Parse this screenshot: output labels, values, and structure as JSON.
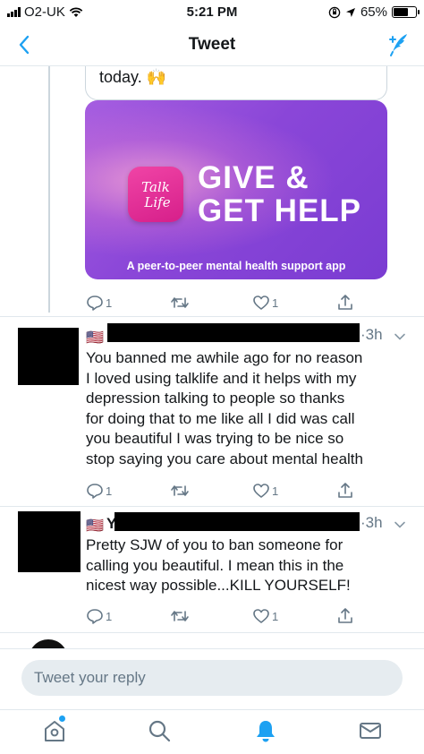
{
  "status_bar": {
    "carrier": "O2-UK",
    "time": "5:21 PM",
    "battery": "65%",
    "battery_level": 0.65
  },
  "nav": {
    "title": "Tweet",
    "icons": [
      "chevron-left-icon",
      "compose-tweet-icon"
    ]
  },
  "original_tweet": {
    "text_end": "today. 🙌",
    "card": {
      "logo_text": "Talk Life",
      "headline_line1": "GIVE &",
      "headline_line2": "GET HELP",
      "caption": "A peer-to-peer mental health support app"
    },
    "actions": {
      "reply_count": "1",
      "like_count": "1"
    }
  },
  "replies": [
    {
      "flag": "🇺🇸",
      "time": "3h",
      "text_lines": [
        "You banned me awhile ago for no reason",
        "I loved using talklife and it helps with my",
        "depression talking to people so thanks",
        "for doing that to me like all I did was call",
        "you beautiful I was trying to be nice so",
        "stop saying you care about mental health"
      ],
      "actions": {
        "reply_count": "1",
        "like_count": "1"
      }
    },
    {
      "flag": "🇺🇸",
      "name_initial": "Y",
      "time": "3h",
      "text_lines": [
        "Pretty SJW of you to ban someone for",
        "calling you beautiful. I mean this in the",
        "nicest way possible...KILL YOURSELF!"
      ],
      "actions": {
        "reply_count": "1",
        "like_count": "1"
      }
    }
  ],
  "composer": {
    "placeholder": "Tweet your reply"
  },
  "tab_bar": {
    "tabs": [
      "home-icon",
      "search-icon",
      "notifications-icon",
      "messages-icon"
    ],
    "active": "notifications-icon"
  },
  "colors": {
    "accent": "#1da1f2",
    "text_secondary": "#657786",
    "card_purple": "#8a46d8",
    "logo_pink": "#e72f97"
  }
}
